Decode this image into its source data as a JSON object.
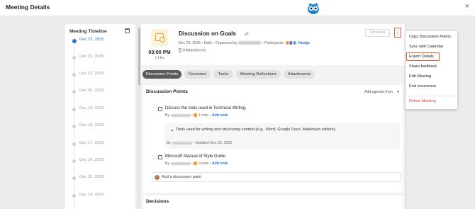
{
  "modal": {
    "title": "Meeting Details",
    "close": "×"
  },
  "timeline": {
    "title": "Meeting Timeline",
    "dates": [
      "Dec 23, 2025",
      "Dec 22, 2025",
      "Dec 21, 2025",
      "Dec 20, 2025",
      "Dec 19, 2025",
      "Dec 18, 2025",
      "Dec 17, 2025",
      "Dec 16, 2025",
      "Dec 15, 2025",
      "Dec 14, 2025"
    ],
    "active_index": 0
  },
  "meeting": {
    "time": "03:00 PM",
    "duration": "1 Hrs",
    "title": "Discussion on Goals",
    "meta_date": "Dec 23, 2025",
    "meta_freq": "Daily",
    "organized_by": "Organized by",
    "participants": "Participants",
    "nudge": "Nudge",
    "attachments": "0 Attachments",
    "conclude": "Conclude",
    "kebab": "⋮"
  },
  "tabs": [
    "Discussion Points",
    "Decisions",
    "Tasks",
    "Meeting Reflections",
    "Attachments"
  ],
  "discussion": {
    "title": "Discussion Points",
    "add_agenda": "Add agenda from",
    "items": [
      {
        "text": "Discuss the tools used in Technical Writing.",
        "by": "By",
        "notes": "1 note",
        "add_note": "Add note"
      },
      {
        "text": "Microsoft Manual of Style Guide",
        "by": "By",
        "notes": "0 note",
        "add_note": "Add note"
      }
    ],
    "note": {
      "text": "Tools used for writing and structuring content (e.g., Word, Google Docs, Markdown editors).",
      "by": "By",
      "updated": "Updated Dec 22, 2025"
    },
    "add_point": "Add a discussion point"
  },
  "decisions": {
    "title": "Decisions"
  },
  "menu": {
    "items": [
      "Copy Discussion Points",
      "Sync with Calendar",
      "Export Details",
      "Share feedback",
      "Edit Meeting",
      "End recurrence"
    ],
    "highlighted_index": 2,
    "danger": "Delete Meeting"
  },
  "colors": {
    "accent": "#2f74d0",
    "highlight": "#e05a2a",
    "danger": "#d9453a"
  }
}
